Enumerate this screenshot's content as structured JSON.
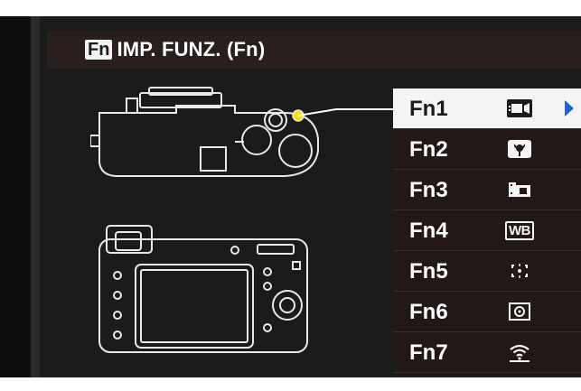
{
  "header": {
    "badge": "Fn",
    "title": "IMP. FUNZ. (Fn)"
  },
  "menu": {
    "items": [
      {
        "label": "Fn1",
        "icon": "movie-icon",
        "selected": true
      },
      {
        "label": "Fn2",
        "icon": "macro-flower-icon",
        "selected": false
      },
      {
        "label": "Fn3",
        "icon": "film-simulation-icon",
        "selected": false
      },
      {
        "label": "Fn4",
        "icon": "wb-icon",
        "icon_text": "WB",
        "selected": false
      },
      {
        "label": "Fn5",
        "icon": "focus-area-icon",
        "selected": false
      },
      {
        "label": "Fn6",
        "icon": "photometry-icon",
        "selected": false
      },
      {
        "label": "Fn7",
        "icon": "wireless-icon",
        "selected": false
      }
    ]
  },
  "colors": {
    "background": "#1b1b1b",
    "title_bar": "#2a1f1f",
    "selected_row": "#f4f4f4",
    "arrow": "#1e64d8",
    "highlight_button": "#f2e600",
    "line": "#ffffff"
  }
}
